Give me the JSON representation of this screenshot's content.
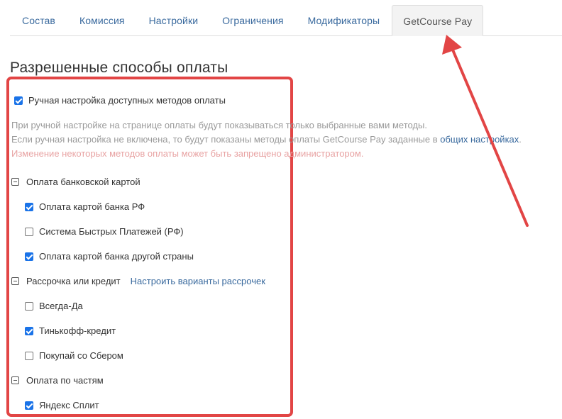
{
  "tabs": [
    "Состав",
    "Комиссия",
    "Настройки",
    "Ограничения",
    "Модификаторы",
    "GetCourse Pay"
  ],
  "active_tab": "GetCourse Pay",
  "section_title": "Разрешенные способы оплаты",
  "manual": {
    "label": "Ручная настройка доступных методов оплаты",
    "checked": true
  },
  "hints": {
    "line1": "При ручной настройке на странице оплаты будут показываться только выбранные вами методы.",
    "line2_prefix": "Если ручная настройка не включена, то будут показаны методы оплаты GetCourse Pay заданные в ",
    "line2_link": "общих настройках",
    "line2_suffix": ".",
    "warning": "Изменение некоторых методов оплаты может быть запрещено администратором."
  },
  "groups": [
    {
      "label": "Оплата банковской картой",
      "items": [
        {
          "label": "Оплата картой банка РФ",
          "checked": true
        },
        {
          "label": "Система Быстрых Платежей (РФ)",
          "checked": false
        },
        {
          "label": "Оплата картой банка другой страны",
          "checked": true
        }
      ]
    },
    {
      "label": "Рассрочка или кредит",
      "link": "Настроить варианты рассрочек",
      "items": [
        {
          "label": "Всегда-Да",
          "checked": false
        },
        {
          "label": "Тинькофф-кредит",
          "checked": true
        },
        {
          "label": "Покупай со Сбером",
          "checked": false
        }
      ]
    },
    {
      "label": "Оплата по частям",
      "items": [
        {
          "label": "Яндекс Сплит",
          "checked": true
        }
      ]
    }
  ],
  "colors": {
    "accent_link": "#3a6a9e",
    "highlight_border": "#e24545",
    "checkbox_on": "#1a73e8"
  }
}
